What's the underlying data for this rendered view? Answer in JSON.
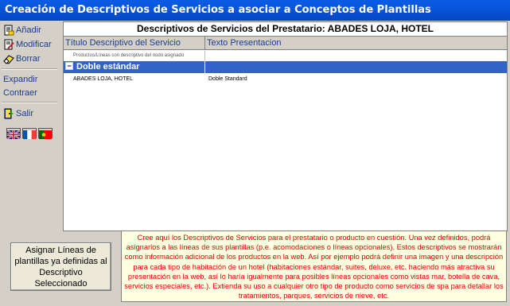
{
  "window": {
    "title": "Creación de Descriptivos de Servicios a asociar a Conceptos de Plantillas"
  },
  "sidebar": {
    "add_label": "Añadir",
    "edit_label": "Modificar",
    "delete_label": "Borrar",
    "expand_label": "Expandir",
    "collapse_label": "Contraer",
    "exit_label": "Salir",
    "languages": [
      "English",
      "Français",
      "Português"
    ]
  },
  "main": {
    "heading": "Descriptivos de Servicios del Prestatario: ABADES LOJA, HOTEL",
    "columns": [
      "Título Descriptivo del Servicio",
      "Texto Presentacion"
    ],
    "group_hint": "Productos/Líneas con descriptivo del nodo asignado",
    "group": {
      "label": "Doble estándar",
      "expander": "−"
    },
    "rows": [
      {
        "name": "ABADES LOJA, HOTEL",
        "text": "Doble Standard"
      }
    ]
  },
  "assign_button_label": "Asignar Líneas de plantillas ya definidas al Descriptivo Seleccionado",
  "info_text": "Cree aquí los Descriptivos de Servicios para el prestatario o producto en cuestión. Una vez definidos, podrá asignarlos a las líneas de sus plantillas (p.e. acomodaciones o líneas opcionales). Estos descriptivos se mostrarán como información adicional de los productos en la web. Así por ejemplo podrá definir una imagen y una descripción para cada tipo de habitación de un hotel (habitaciones estándar, suites, deluxe, etc. haciendo más atractiva su presentación en la web, así lo haría igualmente para posibles líneas opcionales como vistas mar, botella de cava, servicios especiales, etc.). Extienda su uso a cualquier otro tipo de producto como servicios de spa para detallar los tratamientos, parques, servicios de nieve, etc.",
  "colors": {
    "title_bar": "#0854d8",
    "selection": "#3264c8",
    "info_text": "#e00000",
    "info_bg": "#ffffe1",
    "link": "#1c3c8c"
  }
}
